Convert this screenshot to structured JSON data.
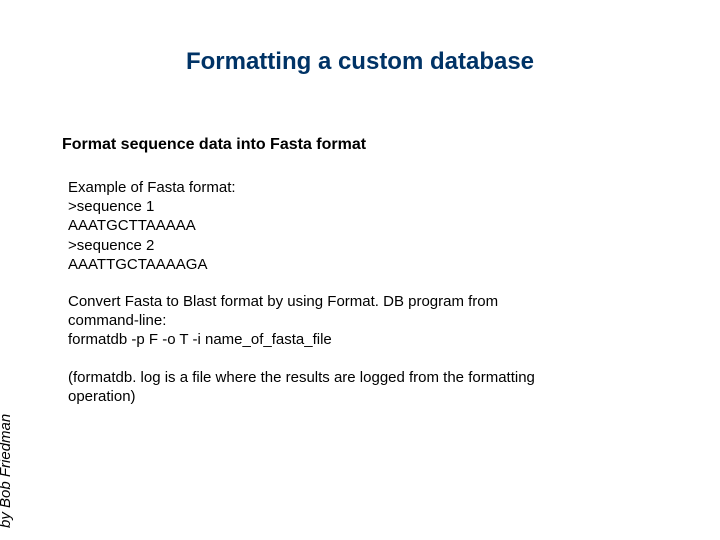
{
  "title": "Formatting a custom database",
  "subheading": "Format sequence data into Fasta format",
  "example": {
    "l1": "Example of Fasta format:",
    "l2": ">sequence 1",
    "l3": "AAATGCTTAAAAA",
    "l4": ">sequence 2",
    "l5": "AAATTGCTAAAAGA"
  },
  "convert": {
    "l1": "Convert Fasta to Blast format by using Format. DB program from",
    "l2": "command-line:",
    "l3": "formatdb -p F -o T -i name_of_fasta_file"
  },
  "log": {
    "l1": "(formatdb. log is a file where the results are logged from the formatting",
    "l2": "operation)"
  },
  "byline": "by Bob Friedman"
}
